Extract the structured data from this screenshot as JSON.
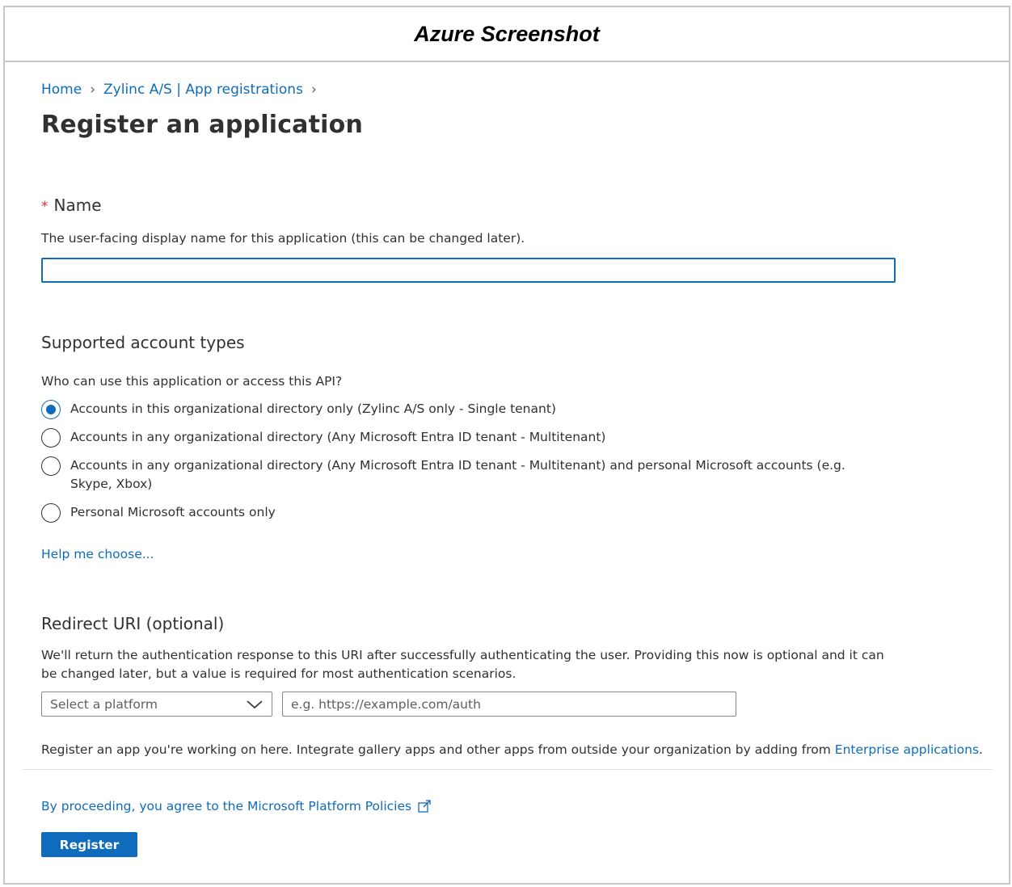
{
  "caption": "Azure Screenshot",
  "breadcrumb": {
    "home": "Home",
    "chevron": "›",
    "app_registrations": "Zylinc A/S | App registrations"
  },
  "page": {
    "title": "Register an application",
    "more_label": "···"
  },
  "name_section": {
    "required_mark": "*",
    "label": "Name",
    "description": "The user-facing display name for this application (this can be changed later).",
    "value": ""
  },
  "accounts_section": {
    "title": "Supported account types",
    "question": "Who can use this application or access this API?",
    "options": [
      {
        "label": "Accounts in this organizational directory only (Zylinc A/S only - Single tenant)",
        "selected": true
      },
      {
        "label": "Accounts in any organizational directory (Any Microsoft Entra ID tenant - Multitenant)",
        "selected": false
      },
      {
        "label": "Accounts in any organizational directory (Any Microsoft Entra ID tenant - Multitenant) and personal Microsoft accounts (e.g. Skype, Xbox)",
        "selected": false
      },
      {
        "label": "Personal Microsoft accounts only",
        "selected": false
      }
    ],
    "help_link": "Help me choose..."
  },
  "redirect_section": {
    "title": "Redirect URI (optional)",
    "description": "We'll return the authentication response to this URI after successfully authenticating the user. Providing this now is optional and it can be changed later, but a value is required for most authentication scenarios.",
    "platform_select": "Select a platform",
    "uri_placeholder": "e.g. https://example.com/auth"
  },
  "register_note": {
    "text": "Register an app you're working on here. Integrate gallery apps and other apps from outside your organization by adding from ",
    "link": "Enterprise applications",
    "suffix": "."
  },
  "footer": {
    "policy_link": "By proceeding, you agree to the Microsoft Platform Policies",
    "register_button": "Register"
  },
  "colors": {
    "accent": "#0f6cbd",
    "required": "#d13438",
    "text": "#323130"
  }
}
